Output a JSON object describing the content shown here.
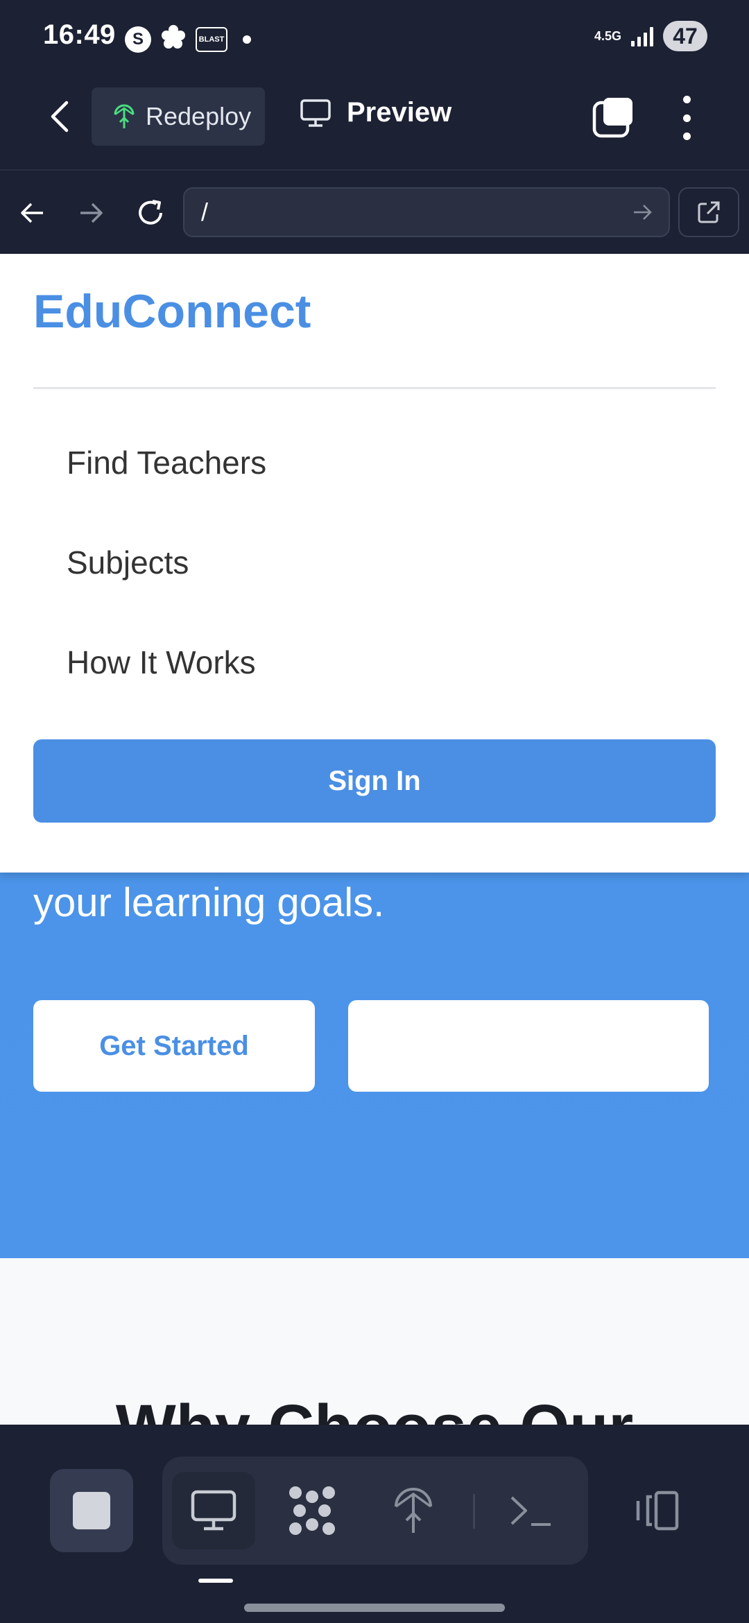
{
  "status_bar": {
    "time": "16:49",
    "notif_icons": [
      "s-app-icon",
      "flower-icon",
      "blast-game-icon"
    ],
    "blast_label": "BLAST",
    "network": "4.5G",
    "battery": "47"
  },
  "toolbar": {
    "redeploy_label": "Redeploy",
    "preview_label": "Preview"
  },
  "browser": {
    "url": "/"
  },
  "menu": {
    "brand": "EduConnect",
    "items": [
      {
        "label": "Find Teachers"
      },
      {
        "label": "Subjects"
      },
      {
        "label": "How It Works"
      }
    ],
    "signin_label": "Sign In"
  },
  "hero": {
    "text": "your learning goals.",
    "primary_button": "Get Started",
    "secondary_button": ""
  },
  "section": {
    "title": "Why Choose Our"
  },
  "colors": {
    "brand": "#4a8fe4",
    "hero_bg": "#4a93e8",
    "chrome_bg": "#1c2133",
    "redeploy_icon": "#4ade80"
  }
}
